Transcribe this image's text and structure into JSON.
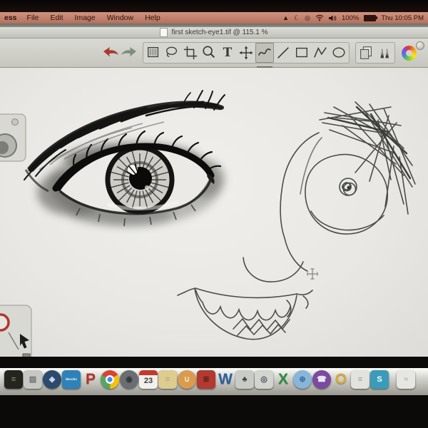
{
  "menu_bar": {
    "app_menu_partial": "ess",
    "menus": [
      "File",
      "Edit",
      "Image",
      "Window",
      "Help"
    ],
    "status": {
      "alert_glyph": "▲",
      "moon_glyph": "☾",
      "circle_glyph": "◎",
      "battery_label": "100%",
      "clock": "Thu 10:05 PM"
    }
  },
  "window": {
    "title": "first sketch-eye1.tif @ 115.1 %",
    "toolbar": {
      "tools": [
        {
          "name": "undo",
          "icon": "undo",
          "group": 0
        },
        {
          "name": "redo",
          "icon": "redo",
          "group": 0
        },
        {
          "name": "select-marquee",
          "icon": "marquee",
          "group": 1
        },
        {
          "name": "select-lasso",
          "icon": "lasso",
          "group": 1
        },
        {
          "name": "crop",
          "icon": "crop",
          "group": 1
        },
        {
          "name": "zoom",
          "icon": "zoom",
          "group": 1
        },
        {
          "name": "text",
          "glyph": "T",
          "group": 1
        },
        {
          "name": "move",
          "icon": "move",
          "group": 1
        },
        {
          "name": "pencil",
          "icon": "pencil",
          "group": 1,
          "selected": true
        },
        {
          "name": "line",
          "icon": "line",
          "group": 1
        },
        {
          "name": "rectangle",
          "icon": "rect",
          "group": 1
        },
        {
          "name": "polyline",
          "icon": "poly",
          "group": 1
        },
        {
          "name": "ellipse",
          "icon": "ellipse",
          "group": 1
        },
        {
          "name": "duplicate",
          "icon": "pages",
          "group": 2
        },
        {
          "name": "pens",
          "icon": "pens",
          "group": 2
        },
        {
          "name": "color-wheel",
          "icon": "colorwheel",
          "group": 3
        }
      ]
    }
  },
  "canvas": {
    "drawings": [
      "realistic-eye-sketch",
      "doodle-face-sketch"
    ]
  },
  "dock": {
    "items": [
      {
        "name": "terminal",
        "kind": "rounded",
        "bg": "#23251e",
        "fg": "#8aa06a",
        "glyph": "≡"
      },
      {
        "name": "preview",
        "kind": "rounded",
        "bg": "#c6c8c4",
        "fg": "#70747a",
        "glyph": "▨"
      },
      {
        "name": "safari",
        "kind": "circle",
        "bg": "#2c4a6e",
        "fg": "#cfdff0",
        "glyph": "◈"
      },
      {
        "name": "ibooks-blue",
        "kind": "rounded",
        "bg": "#2e82b8",
        "fg": "#ffffff",
        "glyph": "iBooks",
        "small": true
      },
      {
        "name": "red-p",
        "kind": "letter",
        "fg": "#b5342c",
        "glyph": "P"
      },
      {
        "name": "chrome",
        "kind": "chrome"
      },
      {
        "name": "photo-booth",
        "kind": "circle",
        "bg": "#6a6e72",
        "fg": "#34383c",
        "glyph": "◉"
      },
      {
        "name": "calendar",
        "kind": "calendar",
        "glyph": "23"
      },
      {
        "name": "stickies",
        "kind": "rounded",
        "bg": "#dccc90",
        "fg": "#b0a070",
        "glyph": "≡"
      },
      {
        "name": "ibooks-orange",
        "kind": "circle",
        "bg": "#d99c4e",
        "fg": "#f6ecd8",
        "glyph": "∪"
      },
      {
        "name": "red-book",
        "kind": "rounded",
        "bg": "#b23a30",
        "fg": "#6a201a",
        "glyph": "≣"
      },
      {
        "name": "word",
        "kind": "letter",
        "fg": "#2b5f9e",
        "glyph": "W"
      },
      {
        "name": "palm-app",
        "kind": "rounded",
        "bg": "#c9cbc7",
        "fg": "#3c403c",
        "glyph": "♣"
      },
      {
        "name": "rosette-app",
        "kind": "rounded",
        "bg": "#d2d4d0",
        "fg": "#4a4e52",
        "glyph": "◎"
      },
      {
        "name": "excel",
        "kind": "letter",
        "fg": "#2e8b40",
        "glyph": "X"
      },
      {
        "name": "globe",
        "kind": "circle",
        "bg": "#88b6da",
        "fg": "#3a6a98",
        "glyph": "⊕"
      },
      {
        "name": "viber",
        "kind": "circle",
        "bg": "#7a4ba0",
        "fg": "#f0eaf6",
        "glyph": "☎"
      },
      {
        "name": "outlook",
        "kind": "letter",
        "fg": "#d9a93c",
        "glyph": "O"
      },
      {
        "name": "notes",
        "kind": "rounded",
        "bg": "#e2e2de",
        "fg": "#9a9a94",
        "glyph": "≡"
      },
      {
        "name": "skype",
        "kind": "rounded",
        "bg": "#3a9cba",
        "fg": "#ffffff",
        "glyph": "S"
      },
      {
        "name": "trash",
        "kind": "rounded",
        "bg": "#e6e6e2",
        "fg": "#b8b8b2",
        "glyph": "≈",
        "gap": true
      }
    ]
  }
}
